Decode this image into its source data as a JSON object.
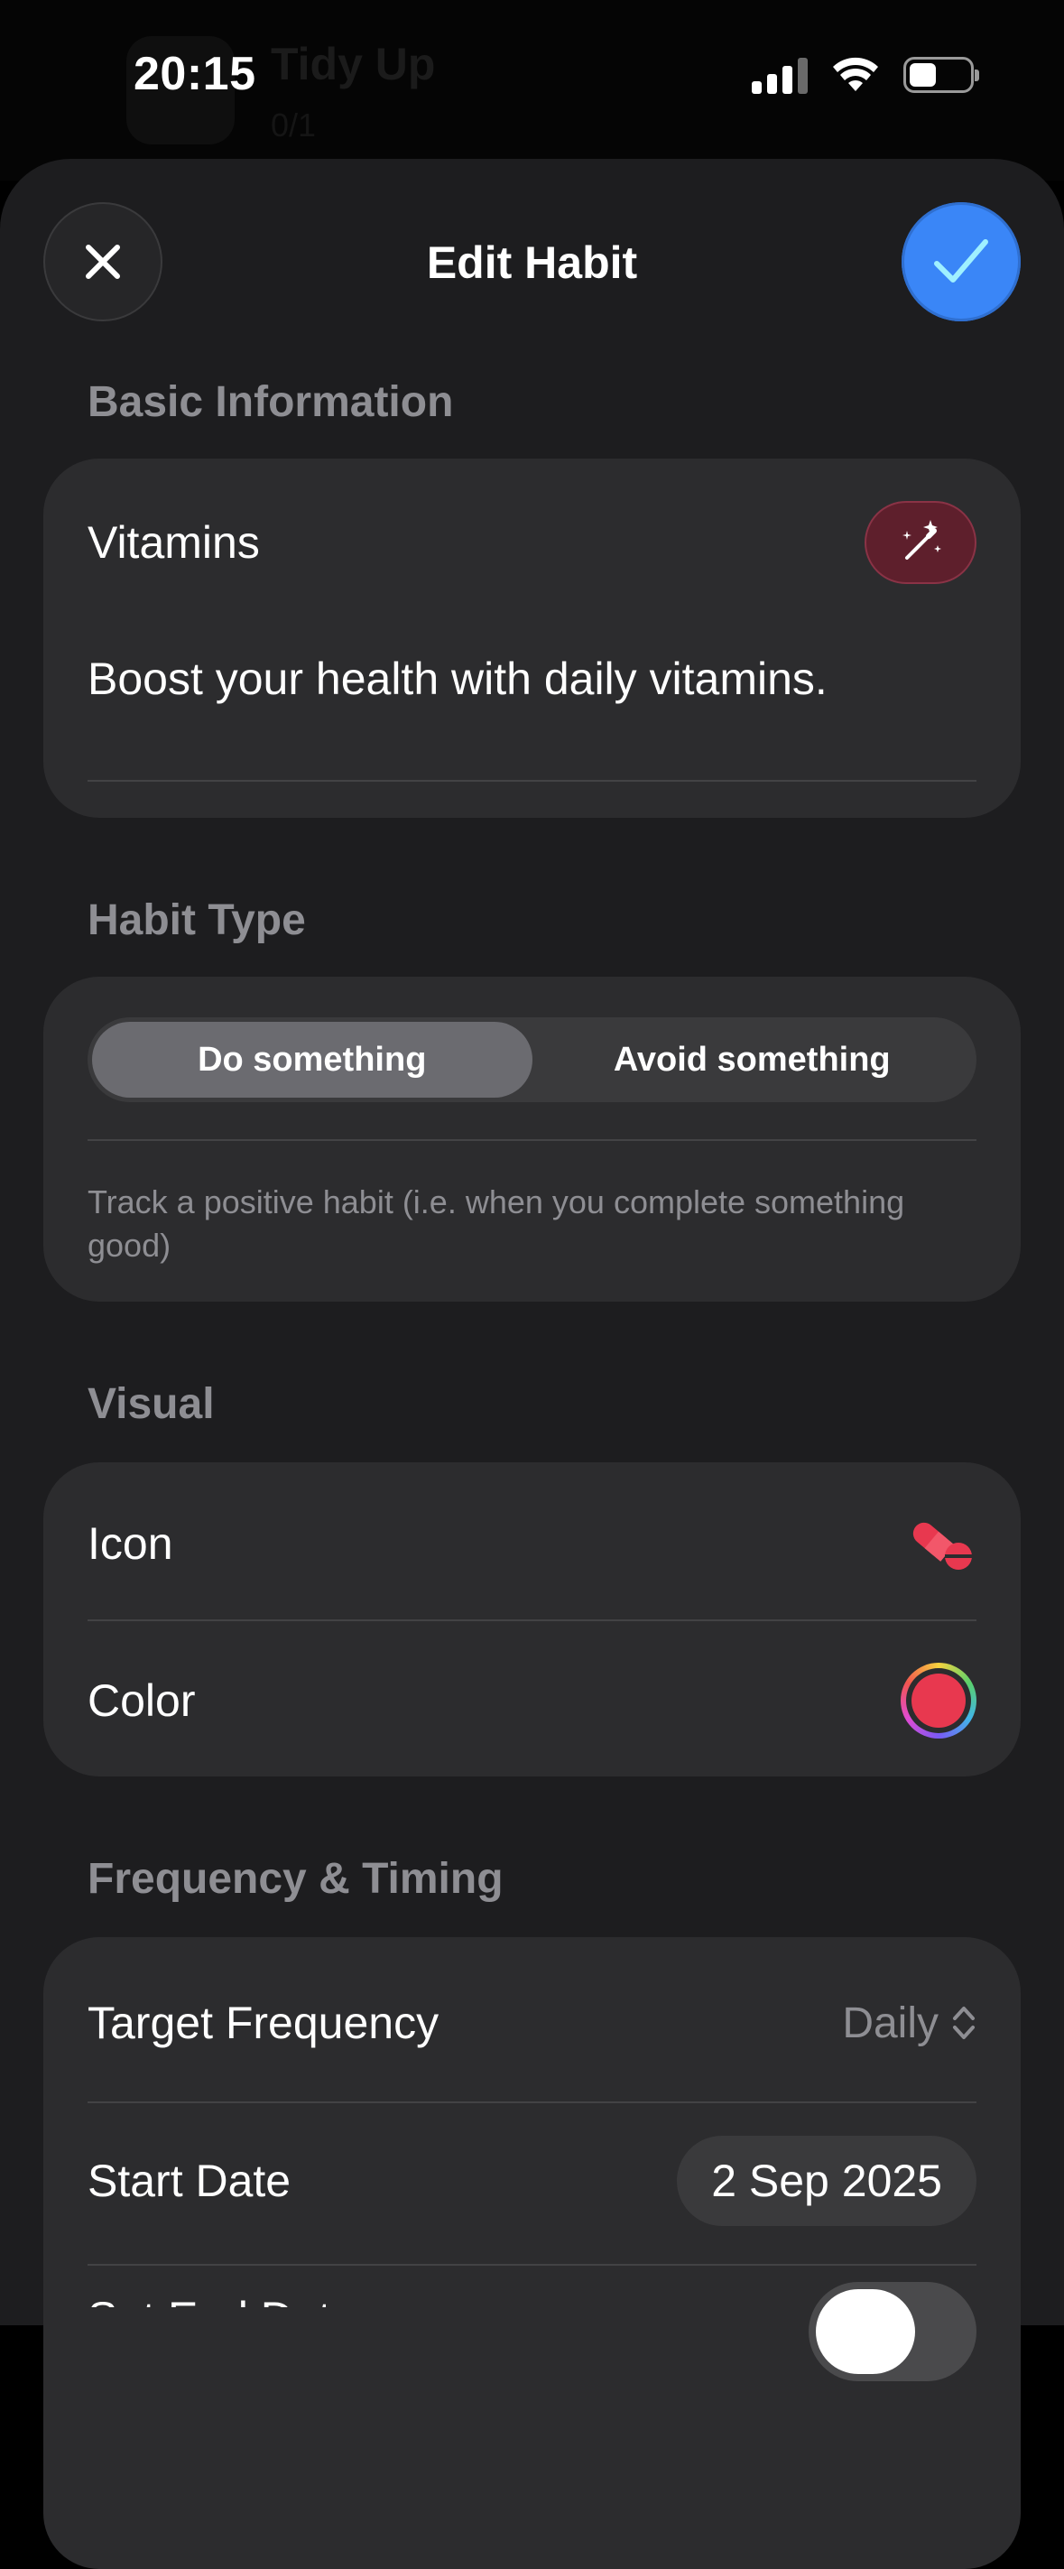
{
  "status_bar": {
    "time": "20:15"
  },
  "background_screen": {
    "title": "Tidy Up",
    "subtitle": "0/1"
  },
  "sheet": {
    "title": "Edit Habit",
    "close_icon": "close-icon",
    "confirm_icon": "checkmark-icon"
  },
  "basic_information": {
    "header": "Basic Information",
    "name_value": "Vitamins",
    "description_value": "Boost your health with daily vitamins.",
    "magic_icon": "magic-wand-icon"
  },
  "habit_type": {
    "header": "Habit Type",
    "options": [
      "Do something",
      "Avoid something"
    ],
    "selected": "Do something",
    "helper": "Track a positive habit (i.e. when you complete something good)"
  },
  "visual": {
    "header": "Visual",
    "icon_label": "Icon",
    "icon_value": "pills-icon",
    "color_label": "Color",
    "color_value": "#e8384f"
  },
  "frequency_timing": {
    "header": "Frequency & Timing",
    "target_frequency_label": "Target Frequency",
    "target_frequency_value": "Daily",
    "start_date_label": "Start Date",
    "start_date_value": "2 Sep 2025",
    "end_date_label": "Set End Date",
    "end_date_enabled": false
  },
  "colors": {
    "accent": "#3a86f7",
    "habit_color": "#e8384f"
  }
}
